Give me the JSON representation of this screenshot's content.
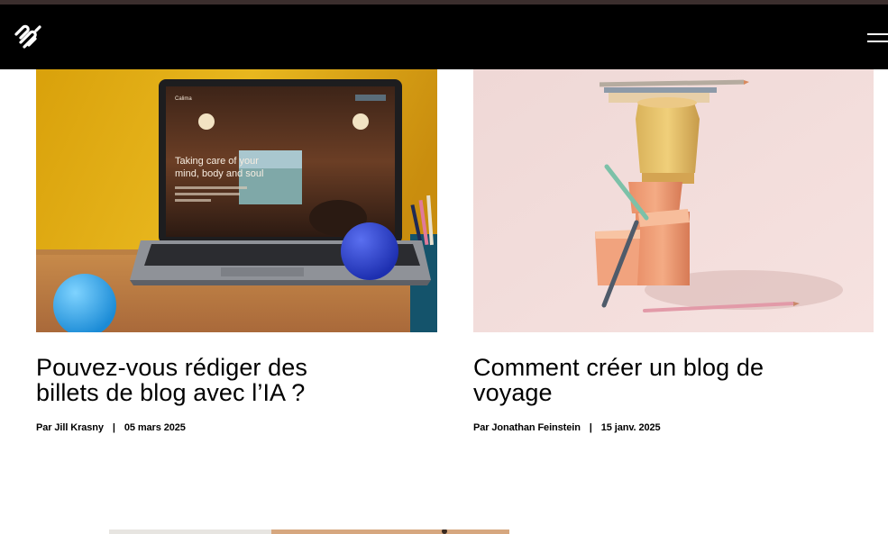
{
  "header": {
    "logo_icon": "squarespace-logo-icon",
    "menu_icon": "hamburger-menu-icon"
  },
  "posts": [
    {
      "title_line1": "Pouvez-vous rédiger des",
      "title_line2": "billets de blog avec l’IA ?",
      "author_label": "Par Jill Krasny",
      "separator": "|",
      "date": "05 mars 2025",
      "image": {
        "screen_brand": "Calima",
        "screen_heading_line1": "Taking care of your",
        "screen_heading_line2": "mind, body and soul"
      }
    },
    {
      "title_line1": "Comment créer un blog de",
      "title_line2": "voyage",
      "author_label": "Par Jonathan Feinstein",
      "separator": "|",
      "date": "15 janv. 2025"
    }
  ],
  "colors": {
    "header_bg": "#000000",
    "top_strip": "#3b2e2d",
    "page_bg": "#ffffff"
  }
}
